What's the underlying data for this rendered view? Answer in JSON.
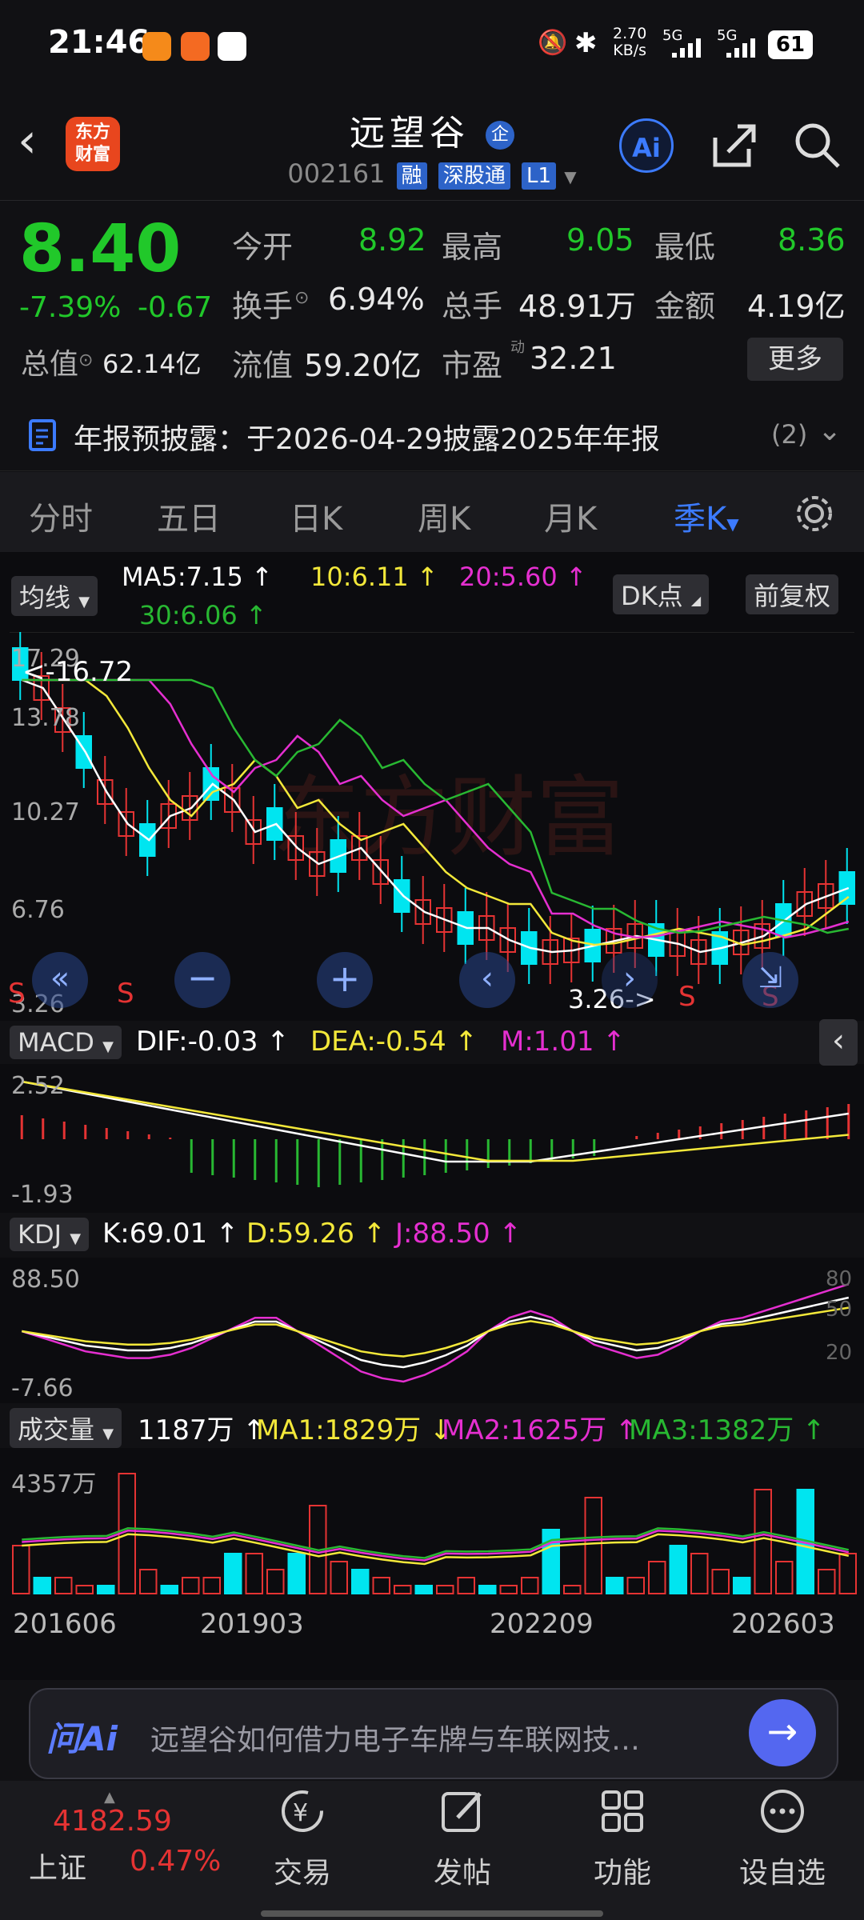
{
  "status_bar": {
    "time": "21:46",
    "net_speed": "2.70\nKB/s",
    "net_speed_a": "2.70",
    "net_speed_b": "KB/s",
    "sig1": "5G",
    "sig2": "5G",
    "battery": "61"
  },
  "header": {
    "logo_line1": "东方",
    "logo_line2": "财富",
    "title": "远望谷",
    "title_badge": "企",
    "code": "002161",
    "tags": [
      "融",
      "深股通",
      "L1"
    ]
  },
  "quote": {
    "price": "8.40",
    "change_pct": "-7.39%",
    "change": "-0.67",
    "open_label": "今开",
    "open": "8.92",
    "high_label": "最高",
    "high": "9.05",
    "low_label": "最低",
    "low": "8.36",
    "turnover_label": "换手",
    "turnover": "6.94%",
    "volume_label": "总手",
    "volume": "48.91万",
    "amount_label": "金额",
    "amount": "4.19亿",
    "mktcap_label": "总值",
    "mktcap": "62.14亿",
    "float_label": "流值",
    "float": "59.20亿",
    "pe_label": "市盈",
    "pe_sup": "动",
    "pe": "32.21",
    "more": "更多"
  },
  "notice": {
    "text": "年报预披露：于2026-04-29披露2025年年报",
    "count": "(2)"
  },
  "tabs": [
    "分时",
    "五日",
    "日K",
    "周K",
    "月K",
    "季K"
  ],
  "tabs_active": 5,
  "kline": {
    "ma_selector": "均线",
    "ma5": "MA5:7.15 ↑",
    "ma10": "10:6.11 ↑",
    "ma20": "20:5.60 ↑",
    "ma30": "30:6.06 ↑",
    "dk_button": "DK点",
    "adjust_button": "前复权",
    "y_labels": [
      "17.29",
      "13.78",
      "10.27",
      "6.76",
      "3.26"
    ],
    "high_marker": "<-16.72",
    "low_marker": "3.26->",
    "watermark": "东方财富",
    "s_mark": "S"
  },
  "macd": {
    "selector": "MACD",
    "dif": "DIF:-0.03 ↑",
    "dea": "DEA:-0.54 ↑",
    "m": "M:1.01 ↑",
    "y_top": "2.52",
    "y_bottom": "-1.93"
  },
  "kdj": {
    "selector": "KDJ",
    "k": "K:69.01 ↑",
    "d": "D:59.26 ↑",
    "j": "J:88.50 ↑",
    "y_top": "88.50",
    "y_bottom": "-7.66",
    "r80": "80",
    "r50": "50",
    "r20": "20"
  },
  "volume": {
    "selector": "成交量",
    "vol": "1187万 ↑",
    "ma1": "MA1:1829万 ↓",
    "ma2": "MA2:1625万 ↑",
    "ma3": "MA3:1382万 ↑",
    "y_top": "4357万"
  },
  "x_axis": [
    "201606",
    "201903",
    "202209",
    "202603"
  ],
  "ai_bar": {
    "logo": "问Ai",
    "placeholder": "远望谷如何借力电子车牌与车联网技…"
  },
  "bottom_nav": {
    "index_value": "4182.59",
    "index_name": "上证",
    "index_change": "0.47%",
    "items": [
      "交易",
      "发帖",
      "功能",
      "设自选"
    ]
  },
  "colors": {
    "up": "#e53333",
    "down": "#00e5f0",
    "ma5": "#ffffff",
    "ma10": "#f3e83a",
    "ma20": "#e52fd0",
    "ma30": "#28b832",
    "accent": "#3c7bff"
  }
}
